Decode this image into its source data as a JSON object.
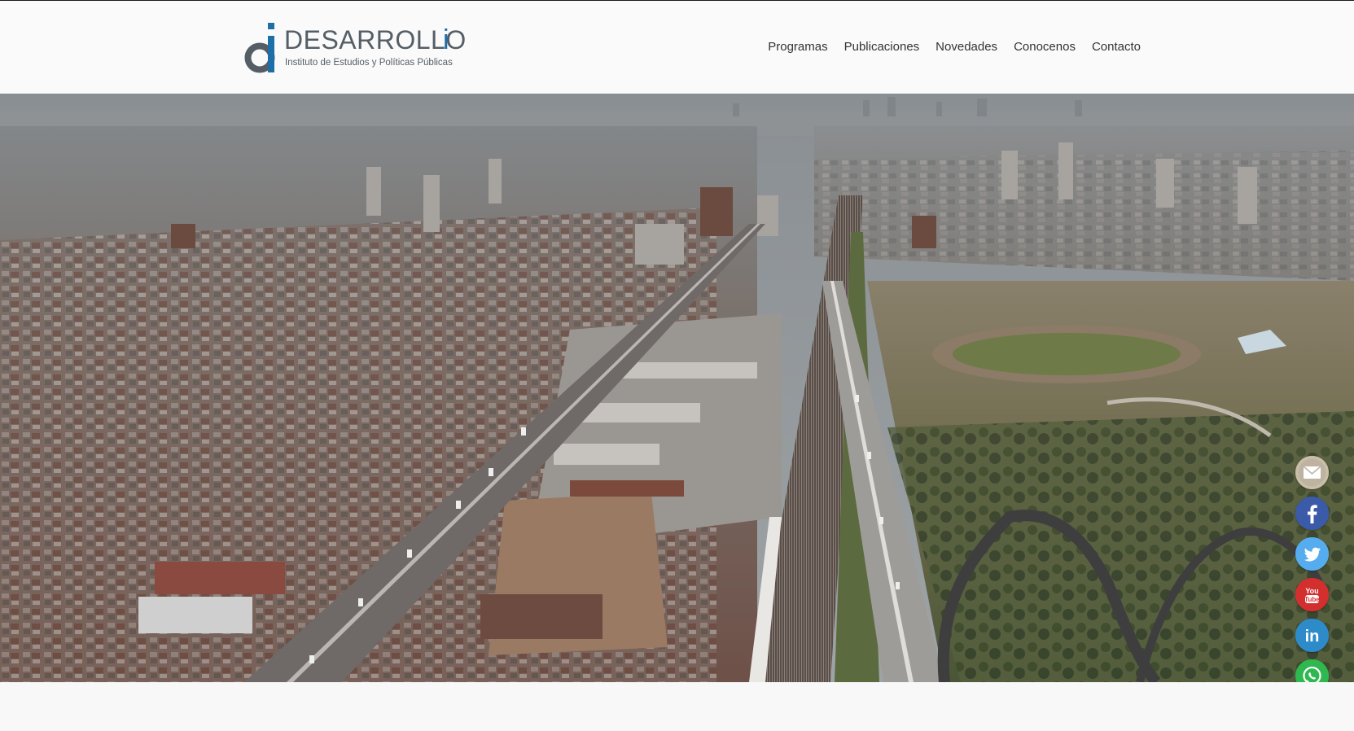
{
  "brand": {
    "name": "DESARROLLO",
    "accent_letter": "i",
    "subtitle": "Instituto de Estudios y Políticas Públicas",
    "primary_color": "#555e66",
    "accent_color": "#1e6ea8"
  },
  "nav": {
    "items": [
      {
        "label": "Programas"
      },
      {
        "label": "Publicaciones"
      },
      {
        "label": "Novedades"
      },
      {
        "label": "Conocenos"
      },
      {
        "label": "Contacto"
      }
    ]
  },
  "hero": {
    "image": "aerial-city-view",
    "description_icon": "aerial-photo"
  },
  "social": {
    "buttons": [
      {
        "icon": "email-icon",
        "color": "#c9bfa9"
      },
      {
        "icon": "facebook-icon",
        "color": "#3b5ba8"
      },
      {
        "icon": "twitter-icon",
        "color": "#55acee"
      },
      {
        "icon": "youtube-icon",
        "color": "#d32f2f",
        "text": "You Tube"
      },
      {
        "icon": "linkedin-icon",
        "color": "#2e8bc9",
        "text": "in"
      },
      {
        "icon": "whatsapp-icon",
        "color": "#2fb84f"
      }
    ]
  }
}
